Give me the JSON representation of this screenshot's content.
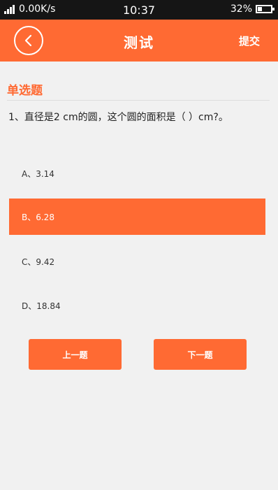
{
  "status_bar": {
    "network_speed": "0.00K/s",
    "time": "10:37",
    "battery_percent": "32%",
    "battery_level": 0.32
  },
  "header": {
    "title": "测试",
    "submit_label": "提交",
    "back_icon": "chevron-left-icon"
  },
  "section": {
    "title": "单选题"
  },
  "question": {
    "text": "1、直径是2 cm的圆，这个圆的面积是（    ）cm?。"
  },
  "options": [
    {
      "label": "A、3.14",
      "selected": false
    },
    {
      "label": "B、6.28",
      "selected": true
    },
    {
      "label": "C、9.42",
      "selected": false
    },
    {
      "label": "D、18.84",
      "selected": false
    }
  ],
  "navigation": {
    "prev_label": "上一题",
    "next_label": "下一题"
  },
  "colors": {
    "accent": "#ff6a33",
    "background": "#f1f1f1",
    "status_bar": "#151515"
  }
}
